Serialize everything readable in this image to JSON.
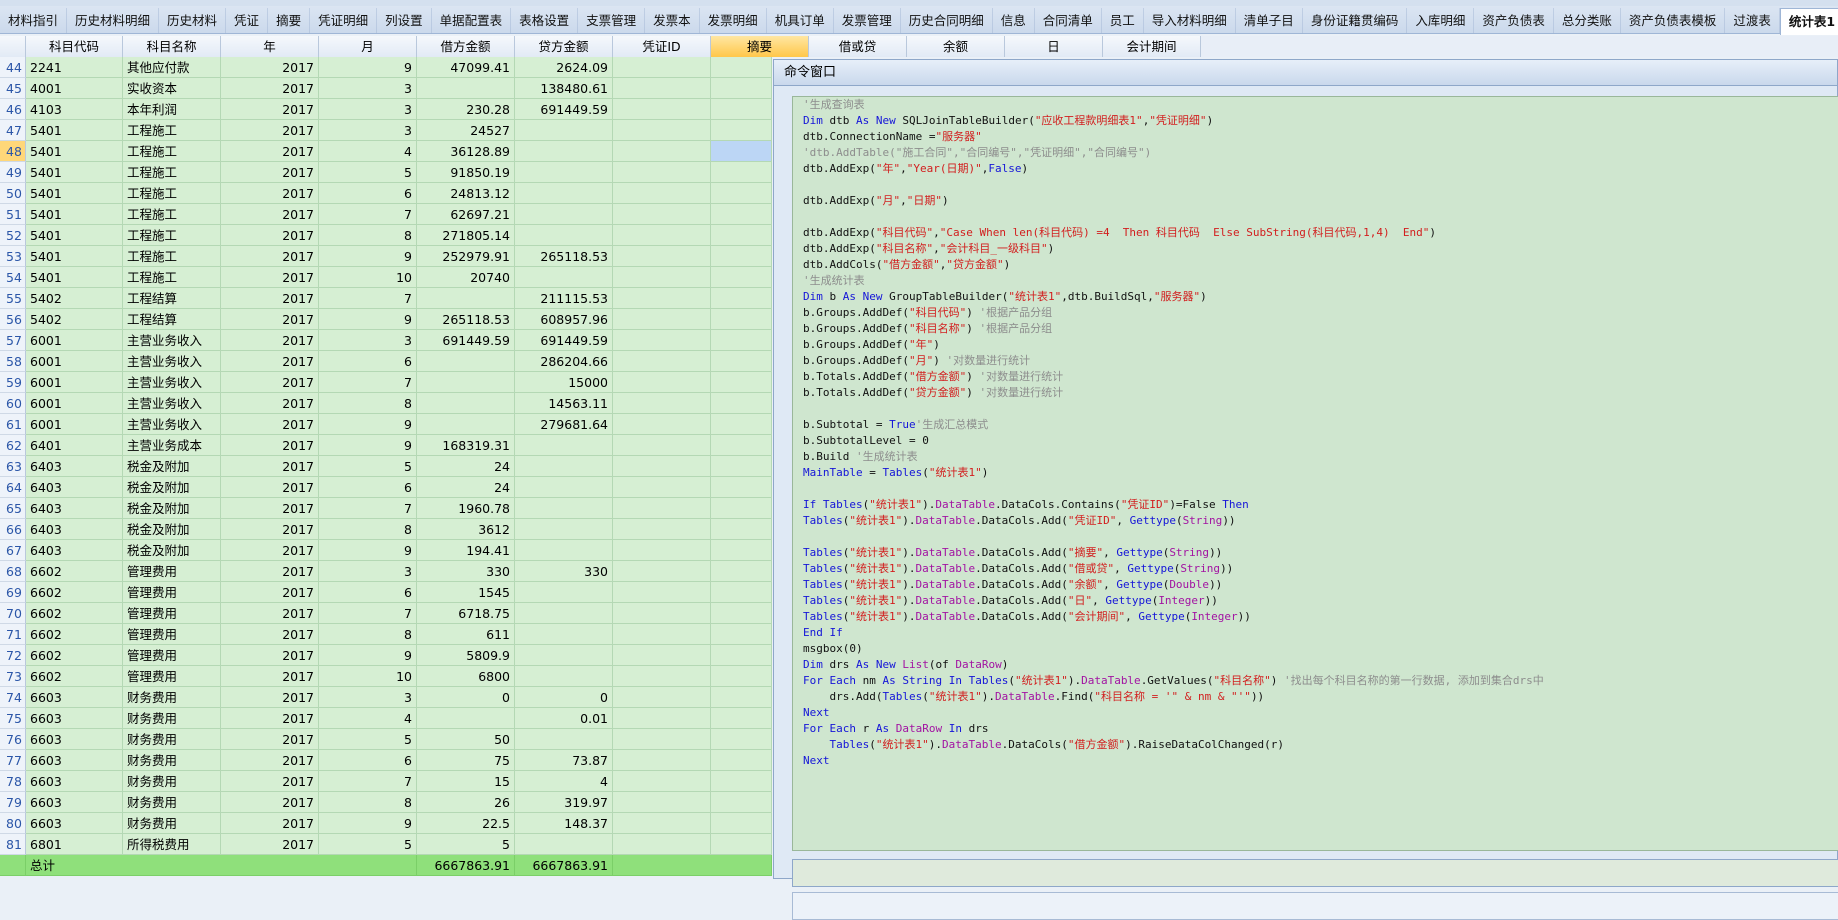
{
  "tabs": [
    "材料指引",
    "历史材料明细",
    "历史材料",
    "凭证",
    "摘要",
    "凭证明细",
    "列设置",
    "单据配置表",
    "表格设置",
    "支票管理",
    "发票本",
    "发票明细",
    "机具订单",
    "发票管理",
    "历史合同明细",
    "信息",
    "合同清单",
    "员工",
    "导入材料明细",
    "清单子目",
    "身份证籍贯编码",
    "入库明细",
    "资产负债表",
    "总分类账",
    "资产负债表模板",
    "过渡表",
    "统计表1"
  ],
  "active_tab": "统计表1",
  "columns": [
    "科目代码",
    "科目名称",
    "年",
    "月",
    "借方金额",
    "贷方金额",
    "凭证ID",
    "摘要",
    "借或贷",
    "余额",
    "日",
    "会计期间"
  ],
  "rows": [
    {
      "n": "44",
      "code": "2241",
      "name": "其他应付款",
      "year": "2017",
      "month": "9",
      "debit": "47099.41",
      "credit": "2624.09"
    },
    {
      "n": "45",
      "code": "4001",
      "name": "实收资本",
      "year": "2017",
      "month": "3",
      "debit": "",
      "credit": "138480.61"
    },
    {
      "n": "46",
      "code": "4103",
      "name": "本年利润",
      "year": "2017",
      "month": "3",
      "debit": "230.28",
      "credit": "691449.59"
    },
    {
      "n": "47",
      "code": "5401",
      "name": "工程施工",
      "year": "2017",
      "month": "3",
      "debit": "24527",
      "credit": ""
    },
    {
      "n": "48",
      "code": "5401",
      "name": "工程施工",
      "year": "2017",
      "month": "4",
      "debit": "36128.89",
      "credit": ""
    },
    {
      "n": "49",
      "code": "5401",
      "name": "工程施工",
      "year": "2017",
      "month": "5",
      "debit": "91850.19",
      "credit": ""
    },
    {
      "n": "50",
      "code": "5401",
      "name": "工程施工",
      "year": "2017",
      "month": "6",
      "debit": "24813.12",
      "credit": ""
    },
    {
      "n": "51",
      "code": "5401",
      "name": "工程施工",
      "year": "2017",
      "month": "7",
      "debit": "62697.21",
      "credit": ""
    },
    {
      "n": "52",
      "code": "5401",
      "name": "工程施工",
      "year": "2017",
      "month": "8",
      "debit": "271805.14",
      "credit": ""
    },
    {
      "n": "53",
      "code": "5401",
      "name": "工程施工",
      "year": "2017",
      "month": "9",
      "debit": "252979.91",
      "credit": "265118.53"
    },
    {
      "n": "54",
      "code": "5401",
      "name": "工程施工",
      "year": "2017",
      "month": "10",
      "debit": "20740",
      "credit": ""
    },
    {
      "n": "55",
      "code": "5402",
      "name": "工程结算",
      "year": "2017",
      "month": "7",
      "debit": "",
      "credit": "211115.53"
    },
    {
      "n": "56",
      "code": "5402",
      "name": "工程结算",
      "year": "2017",
      "month": "9",
      "debit": "265118.53",
      "credit": "608957.96"
    },
    {
      "n": "57",
      "code": "6001",
      "name": "主营业务收入",
      "year": "2017",
      "month": "3",
      "debit": "691449.59",
      "credit": "691449.59"
    },
    {
      "n": "58",
      "code": "6001",
      "name": "主营业务收入",
      "year": "2017",
      "month": "6",
      "debit": "",
      "credit": "286204.66"
    },
    {
      "n": "59",
      "code": "6001",
      "name": "主营业务收入",
      "year": "2017",
      "month": "7",
      "debit": "",
      "credit": "15000"
    },
    {
      "n": "60",
      "code": "6001",
      "name": "主营业务收入",
      "year": "2017",
      "month": "8",
      "debit": "",
      "credit": "14563.11"
    },
    {
      "n": "61",
      "code": "6001",
      "name": "主营业务收入",
      "year": "2017",
      "month": "9",
      "debit": "",
      "credit": "279681.64"
    },
    {
      "n": "62",
      "code": "6401",
      "name": "主营业务成本",
      "year": "2017",
      "month": "9",
      "debit": "168319.31",
      "credit": ""
    },
    {
      "n": "63",
      "code": "6403",
      "name": "税金及附加",
      "year": "2017",
      "month": "5",
      "debit": "24",
      "credit": ""
    },
    {
      "n": "64",
      "code": "6403",
      "name": "税金及附加",
      "year": "2017",
      "month": "6",
      "debit": "24",
      "credit": ""
    },
    {
      "n": "65",
      "code": "6403",
      "name": "税金及附加",
      "year": "2017",
      "month": "7",
      "debit": "1960.78",
      "credit": ""
    },
    {
      "n": "66",
      "code": "6403",
      "name": "税金及附加",
      "year": "2017",
      "month": "8",
      "debit": "3612",
      "credit": ""
    },
    {
      "n": "67",
      "code": "6403",
      "name": "税金及附加",
      "year": "2017",
      "month": "9",
      "debit": "194.41",
      "credit": ""
    },
    {
      "n": "68",
      "code": "6602",
      "name": "管理费用",
      "year": "2017",
      "month": "3",
      "debit": "330",
      "credit": "330"
    },
    {
      "n": "69",
      "code": "6602",
      "name": "管理费用",
      "year": "2017",
      "month": "6",
      "debit": "1545",
      "credit": ""
    },
    {
      "n": "70",
      "code": "6602",
      "name": "管理费用",
      "year": "2017",
      "month": "7",
      "debit": "6718.75",
      "credit": ""
    },
    {
      "n": "71",
      "code": "6602",
      "name": "管理费用",
      "year": "2017",
      "month": "8",
      "debit": "611",
      "credit": ""
    },
    {
      "n": "72",
      "code": "6602",
      "name": "管理费用",
      "year": "2017",
      "month": "9",
      "debit": "5809.9",
      "credit": ""
    },
    {
      "n": "73",
      "code": "6602",
      "name": "管理费用",
      "year": "2017",
      "month": "10",
      "debit": "6800",
      "credit": ""
    },
    {
      "n": "74",
      "code": "6603",
      "name": "财务费用",
      "year": "2017",
      "month": "3",
      "debit": "0",
      "credit": "0"
    },
    {
      "n": "75",
      "code": "6603",
      "name": "财务费用",
      "year": "2017",
      "month": "4",
      "debit": "",
      "credit": "0.01"
    },
    {
      "n": "76",
      "code": "6603",
      "name": "财务费用",
      "year": "2017",
      "month": "5",
      "debit": "50",
      "credit": ""
    },
    {
      "n": "77",
      "code": "6603",
      "name": "财务费用",
      "year": "2017",
      "month": "6",
      "debit": "75",
      "credit": "73.87"
    },
    {
      "n": "78",
      "code": "6603",
      "name": "财务费用",
      "year": "2017",
      "month": "7",
      "debit": "15",
      "credit": "4"
    },
    {
      "n": "79",
      "code": "6603",
      "name": "财务费用",
      "year": "2017",
      "month": "8",
      "debit": "26",
      "credit": "319.97"
    },
    {
      "n": "80",
      "code": "6603",
      "name": "财务费用",
      "year": "2017",
      "month": "9",
      "debit": "22.5",
      "credit": "148.37"
    },
    {
      "n": "81",
      "code": "6801",
      "name": "所得税费用",
      "year": "2017",
      "month": "5",
      "debit": "5",
      "credit": ""
    }
  ],
  "total": {
    "label": "总计",
    "debit": "6667863.91",
    "credit": "6667863.91"
  },
  "selected_row": "48",
  "command_window": {
    "title": "命令窗口",
    "code": [
      [
        [
          "cm",
          "'生成查询表"
        ]
      ],
      [
        [
          "kw",
          "Dim "
        ],
        [
          "",
          "dtb "
        ],
        [
          "kw",
          "As New "
        ],
        [
          "",
          "SQLJoinTableBuilder("
        ],
        [
          "str",
          "\"应收工程款明细表1\""
        ],
        [
          "",
          ","
        ],
        [
          "str",
          "\"凭证明细\""
        ],
        [
          "",
          ")"
        ]
      ],
      [
        [
          "",
          "dtb.ConnectionName ="
        ],
        [
          "str",
          "\"服务器\""
        ]
      ],
      [
        [
          "cm",
          "'dtb.AddTable(\"施工合同\",\"合同编号\",\"凭证明细\",\"合同编号\")"
        ]
      ],
      [
        [
          "",
          "dtb.AddExp("
        ],
        [
          "str",
          "\"年\""
        ],
        [
          "",
          ","
        ],
        [
          "str",
          "\"Year(日期)\""
        ],
        [
          "",
          ","
        ],
        [
          "kw",
          "False"
        ],
        [
          "",
          ")"
        ]
      ],
      [
        [
          "",
          ""
        ]
      ],
      [
        [
          "",
          "dtb.AddExp("
        ],
        [
          "str",
          "\"月\""
        ],
        [
          "",
          ","
        ],
        [
          "str",
          "\"日期\""
        ],
        [
          "",
          ")"
        ]
      ],
      [
        [
          "",
          ""
        ]
      ],
      [
        [
          "",
          "dtb.AddExp("
        ],
        [
          "str",
          "\"科目代码\""
        ],
        [
          "",
          ","
        ],
        [
          "str",
          "\"Case When len(科目代码) =4  Then 科目代码  Else SubString(科目代码,1,4)  End\""
        ],
        [
          "",
          ")"
        ]
      ],
      [
        [
          "",
          "dtb.AddExp("
        ],
        [
          "str",
          "\"科目名称\""
        ],
        [
          "",
          ","
        ],
        [
          "str",
          "\"会计科目_一级科目\""
        ],
        [
          "",
          ")"
        ]
      ],
      [
        [
          "",
          "dtb.AddCols("
        ],
        [
          "str",
          "\"借方金额\""
        ],
        [
          "",
          ","
        ],
        [
          "str",
          "\"贷方金额\""
        ],
        [
          "",
          ")"
        ]
      ],
      [
        [
          "cm",
          "'生成统计表"
        ]
      ],
      [
        [
          "kw",
          "Dim "
        ],
        [
          "",
          "b "
        ],
        [
          "kw",
          "As New "
        ],
        [
          "",
          "GroupTableBuilder("
        ],
        [
          "str",
          "\"统计表1\""
        ],
        [
          "",
          ",dtb.BuildSql,"
        ],
        [
          "str",
          "\"服务器\""
        ],
        [
          "",
          ")"
        ]
      ],
      [
        [
          "",
          "b.Groups.AddDef("
        ],
        [
          "str",
          "\"科目代码\""
        ],
        [
          "",
          ") "
        ],
        [
          "cm",
          "'根据产品分组"
        ]
      ],
      [
        [
          "",
          "b.Groups.AddDef("
        ],
        [
          "str",
          "\"科目名称\""
        ],
        [
          "",
          ") "
        ],
        [
          "cm",
          "'根据产品分组"
        ]
      ],
      [
        [
          "",
          "b.Groups.AddDef("
        ],
        [
          "str",
          "\"年\""
        ],
        [
          "",
          ")"
        ]
      ],
      [
        [
          "",
          "b.Groups.AddDef("
        ],
        [
          "str",
          "\"月\""
        ],
        [
          "",
          ") "
        ],
        [
          "cm",
          "'对数量进行统计"
        ]
      ],
      [
        [
          "",
          "b.Totals.AddDef("
        ],
        [
          "str",
          "\"借方金额\""
        ],
        [
          "",
          ") "
        ],
        [
          "cm",
          "'对数量进行统计"
        ]
      ],
      [
        [
          "",
          "b.Totals.AddDef("
        ],
        [
          "str",
          "\"贷方金额\""
        ],
        [
          "",
          ") "
        ],
        [
          "cm",
          "'对数量进行统计"
        ]
      ],
      [
        [
          "",
          ""
        ]
      ],
      [
        [
          "",
          "b.Subtotal = "
        ],
        [
          "kw",
          "True"
        ],
        [
          "",
          ""
        ],
        [
          "cm",
          "'生成汇总模式"
        ]
      ],
      [
        [
          "",
          "b.SubtotalLevel = 0"
        ]
      ],
      [
        [
          "",
          "b.Build "
        ],
        [
          "cm",
          "'生成统计表"
        ]
      ],
      [
        [
          "kw",
          "MainTable"
        ],
        [
          "",
          " = "
        ],
        [
          "kw",
          "Tables"
        ],
        [
          "",
          "("
        ],
        [
          "str",
          "\"统计表1\""
        ],
        [
          "",
          ")"
        ]
      ],
      [
        [
          "",
          ""
        ]
      ],
      [
        [
          "kw",
          "If Tables"
        ],
        [
          "",
          "("
        ],
        [
          "str",
          "\"统计表1\""
        ],
        [
          "",
          ")."
        ],
        [
          "ty",
          "DataTable"
        ],
        [
          "",
          ".DataCols.Contains("
        ],
        [
          "str",
          "\"凭证ID\""
        ],
        [
          "",
          ")=False "
        ],
        [
          "kw",
          "Then"
        ]
      ],
      [
        [
          "kw",
          "Tables"
        ],
        [
          "",
          "("
        ],
        [
          "str",
          "\"统计表1\""
        ],
        [
          "",
          ")."
        ],
        [
          "ty",
          "DataTable"
        ],
        [
          "",
          ".DataCols.Add("
        ],
        [
          "str",
          "\"凭证ID\""
        ],
        [
          "",
          ", "
        ],
        [
          "kw",
          "Gettype"
        ],
        [
          "",
          "("
        ],
        [
          "ty",
          "String"
        ],
        [
          "",
          "))"
        ]
      ],
      [
        [
          "",
          ""
        ]
      ],
      [
        [
          "kw",
          "Tables"
        ],
        [
          "",
          "("
        ],
        [
          "str",
          "\"统计表1\""
        ],
        [
          "",
          ")."
        ],
        [
          "ty",
          "DataTable"
        ],
        [
          "",
          ".DataCols.Add("
        ],
        [
          "str",
          "\"摘要\""
        ],
        [
          "",
          ", "
        ],
        [
          "kw",
          "Gettype"
        ],
        [
          "",
          "("
        ],
        [
          "ty",
          "String"
        ],
        [
          "",
          "))"
        ]
      ],
      [
        [
          "kw",
          "Tables"
        ],
        [
          "",
          "("
        ],
        [
          "str",
          "\"统计表1\""
        ],
        [
          "",
          ")."
        ],
        [
          "ty",
          "DataTable"
        ],
        [
          "",
          ".DataCols.Add("
        ],
        [
          "str",
          "\"借或贷\""
        ],
        [
          "",
          ", "
        ],
        [
          "kw",
          "Gettype"
        ],
        [
          "",
          "("
        ],
        [
          "ty",
          "String"
        ],
        [
          "",
          "))"
        ]
      ],
      [
        [
          "kw",
          "Tables"
        ],
        [
          "",
          "("
        ],
        [
          "str",
          "\"统计表1\""
        ],
        [
          "",
          ")."
        ],
        [
          "ty",
          "DataTable"
        ],
        [
          "",
          ".DataCols.Add("
        ],
        [
          "str",
          "\"余额\""
        ],
        [
          "",
          ", "
        ],
        [
          "kw",
          "Gettype"
        ],
        [
          "",
          "("
        ],
        [
          "ty",
          "Double"
        ],
        [
          "",
          "))"
        ]
      ],
      [
        [
          "kw",
          "Tables"
        ],
        [
          "",
          "("
        ],
        [
          "str",
          "\"统计表1\""
        ],
        [
          "",
          ")."
        ],
        [
          "ty",
          "DataTable"
        ],
        [
          "",
          ".DataCols.Add("
        ],
        [
          "str",
          "\"日\""
        ],
        [
          "",
          ", "
        ],
        [
          "kw",
          "Gettype"
        ],
        [
          "",
          "("
        ],
        [
          "ty",
          "Integer"
        ],
        [
          "",
          "))"
        ]
      ],
      [
        [
          "kw",
          "Tables"
        ],
        [
          "",
          "("
        ],
        [
          "str",
          "\"统计表1\""
        ],
        [
          "",
          ")."
        ],
        [
          "ty",
          "DataTable"
        ],
        [
          "",
          ".DataCols.Add("
        ],
        [
          "str",
          "\"会计期间\""
        ],
        [
          "",
          ", "
        ],
        [
          "kw",
          "Gettype"
        ],
        [
          "",
          "("
        ],
        [
          "ty",
          "Integer"
        ],
        [
          "",
          "))"
        ]
      ],
      [
        [
          "kw",
          "End If"
        ]
      ],
      [
        [
          "",
          "msgbox(0)"
        ]
      ],
      [
        [
          "kw",
          "Dim "
        ],
        [
          "",
          "drs "
        ],
        [
          "kw",
          "As New "
        ],
        [
          "ty",
          "List"
        ],
        [
          "",
          "(of "
        ],
        [
          "ty",
          "DataRow"
        ],
        [
          "",
          ")"
        ]
      ],
      [
        [
          "kw",
          "For Each "
        ],
        [
          "",
          "nm "
        ],
        [
          "kw",
          "As String In Tables"
        ],
        [
          "",
          "("
        ],
        [
          "str",
          "\"统计表1\""
        ],
        [
          "",
          ")."
        ],
        [
          "ty",
          "DataTable"
        ],
        [
          "",
          ".GetValues("
        ],
        [
          "str",
          "\"科目名称\""
        ],
        [
          "",
          ") "
        ],
        [
          "cm",
          "'找出每个科目名称的第一行数据, 添加到集合drs中"
        ]
      ],
      [
        [
          "",
          "    drs.Add("
        ],
        [
          "kw",
          "Tables"
        ],
        [
          "",
          "("
        ],
        [
          "str",
          "\"统计表1\""
        ],
        [
          "",
          ")."
        ],
        [
          "ty",
          "DataTable"
        ],
        [
          "",
          ".Find("
        ],
        [
          "str",
          "\"科目名称 = '\" & nm & \"'\""
        ],
        [
          "",
          "))"
        ]
      ],
      [
        [
          "kw",
          "Next"
        ]
      ],
      [
        [
          "kw",
          "For Each "
        ],
        [
          "",
          "r "
        ],
        [
          "kw",
          "As "
        ],
        [
          "ty",
          "DataRow"
        ],
        [
          "kw",
          " In "
        ],
        [
          "",
          "drs"
        ]
      ],
      [
        [
          "",
          "    "
        ],
        [
          "kw",
          "Tables"
        ],
        [
          "",
          "("
        ],
        [
          "str",
          "\"统计表1\""
        ],
        [
          "",
          ")."
        ],
        [
          "ty",
          "DataTable"
        ],
        [
          "",
          ".DataCols("
        ],
        [
          "str",
          "\"借方金额\""
        ],
        [
          "",
          ").RaiseDataColChanged(r)"
        ]
      ],
      [
        [
          "kw",
          "Next"
        ]
      ]
    ]
  }
}
